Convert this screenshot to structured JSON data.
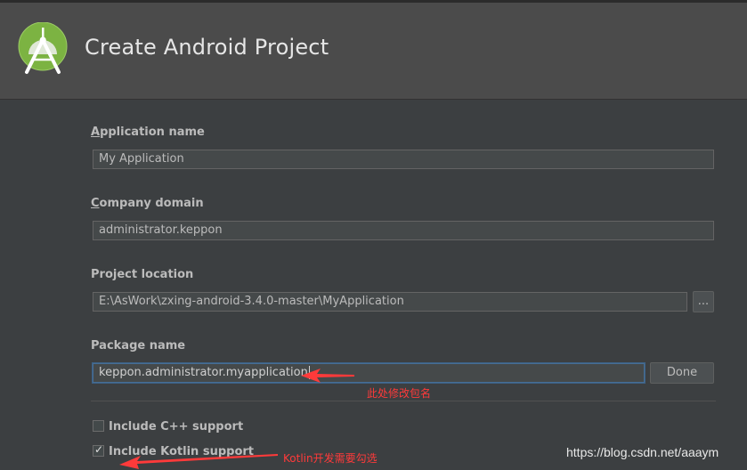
{
  "window": {
    "title": "Create Android Project"
  },
  "fields": {
    "app_name": {
      "label_mnemonic": "A",
      "label_rest": "pplication name",
      "value": "My Application"
    },
    "company_domain": {
      "label_mnemonic": "C",
      "label_rest": "ompany domain",
      "value": "administrator.keppon"
    },
    "project_location": {
      "label": "Project location",
      "value": "E:\\AsWork\\zxing-android-3.4.0-master\\MyApplication",
      "browse_label": "..."
    },
    "package_name": {
      "label": "Package name",
      "value": "keppon.administrator.myapplication",
      "done_label": "Done"
    }
  },
  "options": {
    "cpp": {
      "label": "Include C++ support",
      "checked": false
    },
    "kotlin": {
      "label": "Include Kotlin support",
      "checked": true
    }
  },
  "annotations": {
    "package_note": "此处修改包名",
    "kotlin_note": "Kotlin开发需要勾选",
    "color": "#ff3a3a"
  },
  "watermark": "https://blog.csdn.net/aaaym"
}
